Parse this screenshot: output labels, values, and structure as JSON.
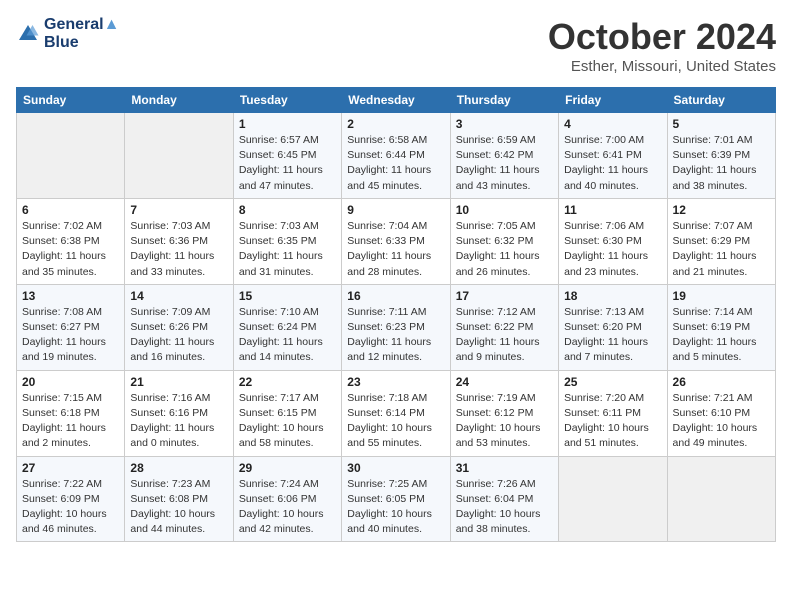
{
  "header": {
    "logo_line1": "General",
    "logo_line2": "Blue",
    "month_title": "October 2024",
    "subtitle": "Esther, Missouri, United States"
  },
  "weekdays": [
    "Sunday",
    "Monday",
    "Tuesday",
    "Wednesday",
    "Thursday",
    "Friday",
    "Saturday"
  ],
  "weeks": [
    [
      {
        "day": "",
        "sunrise": "",
        "sunset": "",
        "daylight": ""
      },
      {
        "day": "",
        "sunrise": "",
        "sunset": "",
        "daylight": ""
      },
      {
        "day": "1",
        "sunrise": "Sunrise: 6:57 AM",
        "sunset": "Sunset: 6:45 PM",
        "daylight": "Daylight: 11 hours and 47 minutes."
      },
      {
        "day": "2",
        "sunrise": "Sunrise: 6:58 AM",
        "sunset": "Sunset: 6:44 PM",
        "daylight": "Daylight: 11 hours and 45 minutes."
      },
      {
        "day": "3",
        "sunrise": "Sunrise: 6:59 AM",
        "sunset": "Sunset: 6:42 PM",
        "daylight": "Daylight: 11 hours and 43 minutes."
      },
      {
        "day": "4",
        "sunrise": "Sunrise: 7:00 AM",
        "sunset": "Sunset: 6:41 PM",
        "daylight": "Daylight: 11 hours and 40 minutes."
      },
      {
        "day": "5",
        "sunrise": "Sunrise: 7:01 AM",
        "sunset": "Sunset: 6:39 PM",
        "daylight": "Daylight: 11 hours and 38 minutes."
      }
    ],
    [
      {
        "day": "6",
        "sunrise": "Sunrise: 7:02 AM",
        "sunset": "Sunset: 6:38 PM",
        "daylight": "Daylight: 11 hours and 35 minutes."
      },
      {
        "day": "7",
        "sunrise": "Sunrise: 7:03 AM",
        "sunset": "Sunset: 6:36 PM",
        "daylight": "Daylight: 11 hours and 33 minutes."
      },
      {
        "day": "8",
        "sunrise": "Sunrise: 7:03 AM",
        "sunset": "Sunset: 6:35 PM",
        "daylight": "Daylight: 11 hours and 31 minutes."
      },
      {
        "day": "9",
        "sunrise": "Sunrise: 7:04 AM",
        "sunset": "Sunset: 6:33 PM",
        "daylight": "Daylight: 11 hours and 28 minutes."
      },
      {
        "day": "10",
        "sunrise": "Sunrise: 7:05 AM",
        "sunset": "Sunset: 6:32 PM",
        "daylight": "Daylight: 11 hours and 26 minutes."
      },
      {
        "day": "11",
        "sunrise": "Sunrise: 7:06 AM",
        "sunset": "Sunset: 6:30 PM",
        "daylight": "Daylight: 11 hours and 23 minutes."
      },
      {
        "day": "12",
        "sunrise": "Sunrise: 7:07 AM",
        "sunset": "Sunset: 6:29 PM",
        "daylight": "Daylight: 11 hours and 21 minutes."
      }
    ],
    [
      {
        "day": "13",
        "sunrise": "Sunrise: 7:08 AM",
        "sunset": "Sunset: 6:27 PM",
        "daylight": "Daylight: 11 hours and 19 minutes."
      },
      {
        "day": "14",
        "sunrise": "Sunrise: 7:09 AM",
        "sunset": "Sunset: 6:26 PM",
        "daylight": "Daylight: 11 hours and 16 minutes."
      },
      {
        "day": "15",
        "sunrise": "Sunrise: 7:10 AM",
        "sunset": "Sunset: 6:24 PM",
        "daylight": "Daylight: 11 hours and 14 minutes."
      },
      {
        "day": "16",
        "sunrise": "Sunrise: 7:11 AM",
        "sunset": "Sunset: 6:23 PM",
        "daylight": "Daylight: 11 hours and 12 minutes."
      },
      {
        "day": "17",
        "sunrise": "Sunrise: 7:12 AM",
        "sunset": "Sunset: 6:22 PM",
        "daylight": "Daylight: 11 hours and 9 minutes."
      },
      {
        "day": "18",
        "sunrise": "Sunrise: 7:13 AM",
        "sunset": "Sunset: 6:20 PM",
        "daylight": "Daylight: 11 hours and 7 minutes."
      },
      {
        "day": "19",
        "sunrise": "Sunrise: 7:14 AM",
        "sunset": "Sunset: 6:19 PM",
        "daylight": "Daylight: 11 hours and 5 minutes."
      }
    ],
    [
      {
        "day": "20",
        "sunrise": "Sunrise: 7:15 AM",
        "sunset": "Sunset: 6:18 PM",
        "daylight": "Daylight: 11 hours and 2 minutes."
      },
      {
        "day": "21",
        "sunrise": "Sunrise: 7:16 AM",
        "sunset": "Sunset: 6:16 PM",
        "daylight": "Daylight: 11 hours and 0 minutes."
      },
      {
        "day": "22",
        "sunrise": "Sunrise: 7:17 AM",
        "sunset": "Sunset: 6:15 PM",
        "daylight": "Daylight: 10 hours and 58 minutes."
      },
      {
        "day": "23",
        "sunrise": "Sunrise: 7:18 AM",
        "sunset": "Sunset: 6:14 PM",
        "daylight": "Daylight: 10 hours and 55 minutes."
      },
      {
        "day": "24",
        "sunrise": "Sunrise: 7:19 AM",
        "sunset": "Sunset: 6:12 PM",
        "daylight": "Daylight: 10 hours and 53 minutes."
      },
      {
        "day": "25",
        "sunrise": "Sunrise: 7:20 AM",
        "sunset": "Sunset: 6:11 PM",
        "daylight": "Daylight: 10 hours and 51 minutes."
      },
      {
        "day": "26",
        "sunrise": "Sunrise: 7:21 AM",
        "sunset": "Sunset: 6:10 PM",
        "daylight": "Daylight: 10 hours and 49 minutes."
      }
    ],
    [
      {
        "day": "27",
        "sunrise": "Sunrise: 7:22 AM",
        "sunset": "Sunset: 6:09 PM",
        "daylight": "Daylight: 10 hours and 46 minutes."
      },
      {
        "day": "28",
        "sunrise": "Sunrise: 7:23 AM",
        "sunset": "Sunset: 6:08 PM",
        "daylight": "Daylight: 10 hours and 44 minutes."
      },
      {
        "day": "29",
        "sunrise": "Sunrise: 7:24 AM",
        "sunset": "Sunset: 6:06 PM",
        "daylight": "Daylight: 10 hours and 42 minutes."
      },
      {
        "day": "30",
        "sunrise": "Sunrise: 7:25 AM",
        "sunset": "Sunset: 6:05 PM",
        "daylight": "Daylight: 10 hours and 40 minutes."
      },
      {
        "day": "31",
        "sunrise": "Sunrise: 7:26 AM",
        "sunset": "Sunset: 6:04 PM",
        "daylight": "Daylight: 10 hours and 38 minutes."
      },
      {
        "day": "",
        "sunrise": "",
        "sunset": "",
        "daylight": ""
      },
      {
        "day": "",
        "sunrise": "",
        "sunset": "",
        "daylight": ""
      }
    ]
  ]
}
